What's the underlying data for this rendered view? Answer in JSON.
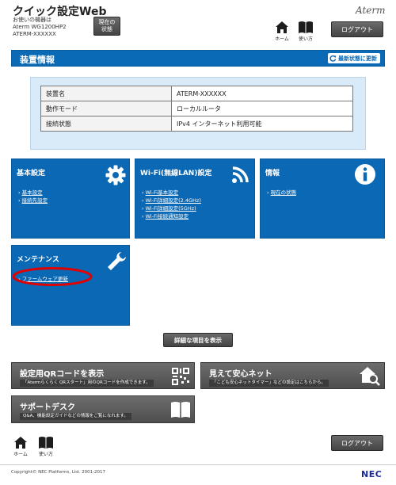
{
  "header": {
    "title": "クイック設定Web",
    "device_lines": [
      "お使いの機器は",
      "Aterm WG1200HP2",
      "ATERM-XXXXXX"
    ],
    "status_button": [
      "現在の",
      "状態"
    ],
    "nav": {
      "home": "ホーム",
      "help": "使い方"
    },
    "brand": "Aterm",
    "logout": "ログアウト"
  },
  "section": {
    "title": "装置情報",
    "refresh": "最新状態に更新"
  },
  "device_info": {
    "rows": [
      {
        "key": "装置名",
        "value": "ATERM-XXXXXX"
      },
      {
        "key": "動作モード",
        "value": "ローカルルータ"
      },
      {
        "key": "接続状態",
        "value": "IPv4 インターネット利用可能"
      }
    ]
  },
  "tiles": {
    "basic": {
      "title": "基本設定",
      "links": [
        "基本設定",
        "接続先設定"
      ]
    },
    "wifi": {
      "title": "Wi-Fi(無線LAN)設定",
      "links": [
        "Wi-Fi基本設定",
        "Wi-Fi詳細設定(2.4GHz)",
        "Wi-Fi詳細設定(5GHz)",
        "Wi-Fi接続通知設定"
      ]
    },
    "info": {
      "title": "情報",
      "links": [
        "現在の状態"
      ]
    },
    "maint": {
      "title": "メンテナンス",
      "links": [
        "ファームウェア更新"
      ]
    }
  },
  "detail_button": "詳細な項目を表示",
  "banners": {
    "qr": {
      "title": "設定用QRコードを表示",
      "sub": "「Atermらくらく QRスタート」用のQRコードを作成できます。"
    },
    "mieru": {
      "title": "見えて安心ネット",
      "sub": "「こども安心ネットタイマー」などの設定はこちらから。"
    },
    "support": {
      "title": "サポートデスク",
      "sub": "Q&A、機能設定ガイドなどの情報をご覧になれます。"
    }
  },
  "footer": {
    "home": "ホーム",
    "help": "使い方",
    "logout": "ログアウト",
    "copyright": "Copyright© NEC Platforms, Ltd. 2001-2017",
    "nec": "NEC"
  },
  "colors": {
    "tile_blue": "#0b68b4",
    "highlight_red": "#e00000",
    "nec_blue": "#1a2a9a"
  }
}
